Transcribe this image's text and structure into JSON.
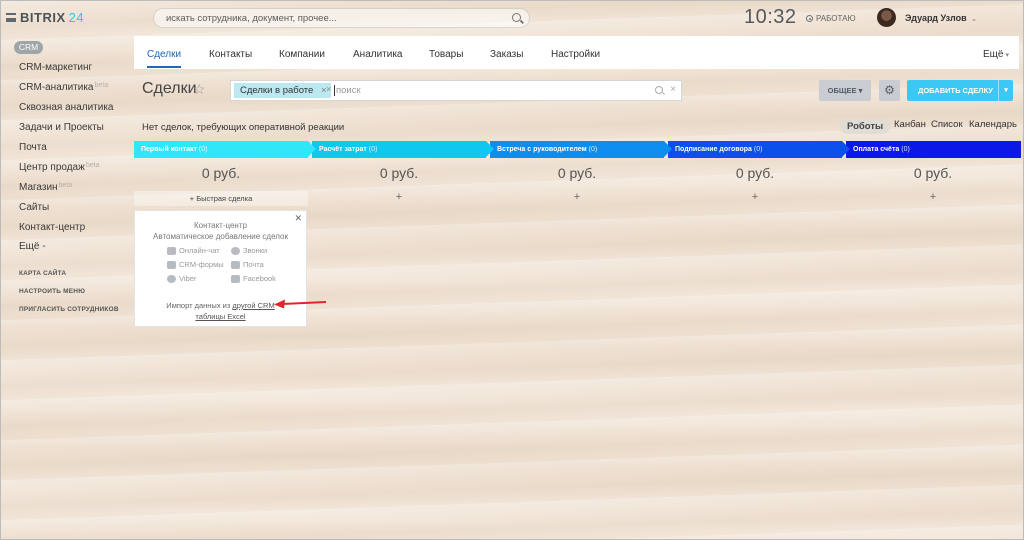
{
  "header": {
    "logo": "BITRIX",
    "logo_num": "24",
    "search_placeholder": "искать сотрудника, документ, прочее...",
    "clock": "10:32",
    "status": "РАБОТАЮ",
    "user_name": "Эдуард Узлов"
  },
  "sidebar": {
    "badge": "CRM",
    "items": [
      {
        "label": "CRM-маркетинг",
        "sup": ""
      },
      {
        "label": "CRM-аналитика",
        "sup": "beta"
      },
      {
        "label": "Сквозная аналитика",
        "sup": ""
      },
      {
        "label": "Задачи и Проекты",
        "sup": ""
      },
      {
        "label": "Почта",
        "sup": ""
      },
      {
        "label": "Центр продаж",
        "sup": "beta"
      },
      {
        "label": "Магазин",
        "sup": "beta"
      },
      {
        "label": "Сайты",
        "sup": ""
      },
      {
        "label": "Контакт-центр",
        "sup": ""
      },
      {
        "label": "Ещё -",
        "sup": ""
      }
    ],
    "small": [
      "КАРТА САЙТА",
      "НАСТРОИТЬ МЕНЮ",
      "ПРИГЛАСИТЬ СОТРУДНИКОВ"
    ]
  },
  "tabs": [
    "Сделки",
    "Контакты",
    "Компании",
    "Аналитика",
    "Товары",
    "Заказы",
    "Настройки"
  ],
  "tab_more": "Ещё",
  "toolbar": {
    "title": "Сделки",
    "filter_tag": "Сделки в работе",
    "filter_placeholder": "поиск",
    "general_label": "ОБЩЕЕ",
    "add_label": "ДОБАВИТЬ СДЕЛКУ"
  },
  "notice": "Нет сделок, требующих оперативной реакции",
  "views": [
    "Роботы",
    "Канбан",
    "Список",
    "Календарь"
  ],
  "stages": [
    {
      "name": "Первый контакт",
      "count": "(0)",
      "color": "#2fe7f6",
      "sum": "0 руб."
    },
    {
      "name": "Расчёт затрат",
      "count": "(0)",
      "color": "#10c7f0",
      "sum": "0 руб."
    },
    {
      "name": "Встреча с руководителем",
      "count": "(0)",
      "color": "#0c8ef0",
      "sum": "0 руб."
    },
    {
      "name": "Подписание договора",
      "count": "(0)",
      "color": "#0b4fec",
      "sum": "0 руб."
    },
    {
      "name": "Оплата счёта",
      "count": "(0)",
      "color": "#0b18e6",
      "sum": "0 руб."
    }
  ],
  "quick_deal": "+ Быстрая сделка",
  "plus": "+",
  "contact_center": {
    "title1": "Контакт-центр",
    "title2": "Автоматическое добавление сделок",
    "channels": [
      "Онлайн-чат",
      "Звонки",
      "CRM-формы",
      "Почта",
      "Viber",
      "Facebook"
    ],
    "import_text": "Импорт данных из",
    "import_link1": "другой CRM",
    "import_link2": "таблицы Excel"
  }
}
